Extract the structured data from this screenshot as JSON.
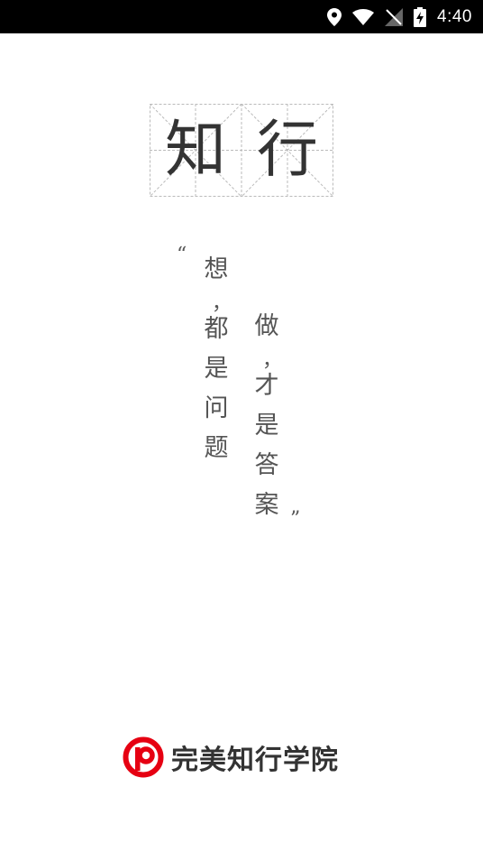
{
  "status_bar": {
    "time": "4:40",
    "icons": [
      "location-icon",
      "wifi-icon",
      "no-signal-icon",
      "battery-charging-icon"
    ]
  },
  "title": {
    "char1": "知",
    "char2": "行"
  },
  "quote": {
    "open_mark": "“",
    "close_mark": "”",
    "line1": [
      "想",
      "，",
      "都",
      "是",
      "问",
      "题"
    ],
    "line2": [
      "做",
      "，",
      "才",
      "是",
      "答",
      "案"
    ]
  },
  "brand": {
    "name": "完美知行学院",
    "logo_color": "#e60012"
  }
}
